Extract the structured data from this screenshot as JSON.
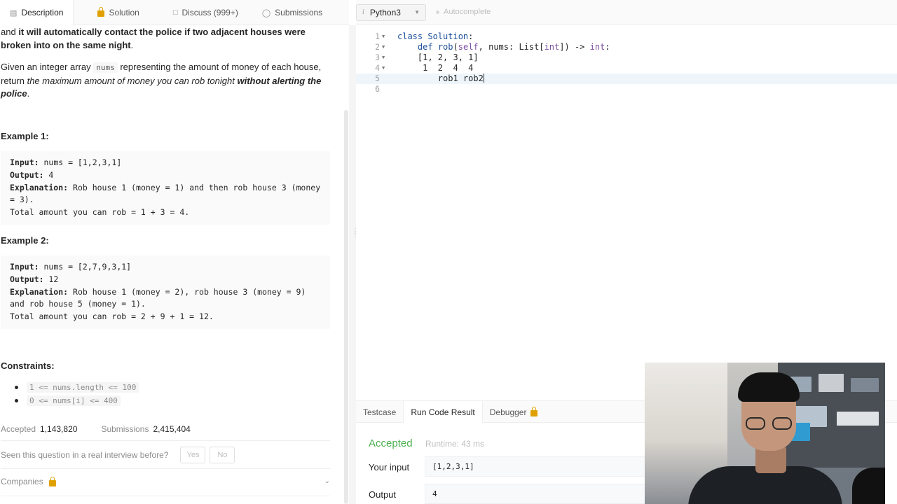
{
  "top_tabs": [
    {
      "label": "Description",
      "icon": "document-icon",
      "active": true
    },
    {
      "label": "Solution",
      "icon": "lock-icon"
    },
    {
      "label": "Discuss (999+)",
      "icon": "chat-icon"
    },
    {
      "label": "Submissions",
      "icon": "clock-icon"
    }
  ],
  "editor_toolbar": {
    "language": "Python3",
    "language_info_icon": "i",
    "autocomplete": "Autocomplete"
  },
  "description": {
    "intro_plain": "and ",
    "intro_bold": "it will automatically contact the police if two adjacent houses were broken into on the same night",
    "intro_end": ".",
    "task_a": "Given an integer array ",
    "task_code": "nums",
    "task_b": " representing the amount of money of each house, return ",
    "task_italic": "the maximum amount of money you can rob tonight",
    "task_space": " ",
    "task_bold_italic": "without alerting the police",
    "task_end": ".",
    "example1_title": "Example 1:",
    "example1": {
      "input_label": "Input:",
      "input": " nums = [1,2,3,1]",
      "output_label": "Output:",
      "output": " 4",
      "expl_label": "Explanation:",
      "expl_1": " Rob house 1 (money = 1) and then rob house 3 (money",
      "expl_2": "= 3).",
      "expl_3": "Total amount you can rob = 1 + 3 = 4."
    },
    "example2_title": "Example 2:",
    "example2": {
      "input_label": "Input:",
      "input": " nums = [2,7,9,3,1]",
      "output_label": "Output:",
      "output": " 12",
      "expl_label": "Explanation:",
      "expl_1": " Rob house 1 (money = 2), rob house 3 (money = 9)",
      "expl_2": "and rob house 5 (money = 1).",
      "expl_3": "Total amount you can rob = 2 + 9 + 1 = 12."
    },
    "constraints_title": "Constraints:",
    "constraints": [
      "1 <= nums.length <= 100",
      "0 <= nums[i] <= 400"
    ],
    "accepted_label": "Accepted",
    "accepted_value": "1,143,820",
    "submissions_label": "Submissions",
    "submissions_value": "2,415,404",
    "interview_question": "Seen this question in a real interview before?",
    "yes": "Yes",
    "no": "No",
    "companies": "Companies"
  },
  "code": {
    "line_numbers": [
      "1",
      "2",
      "3",
      "4",
      "5",
      "6"
    ],
    "line1": {
      "kw": "class",
      "name": "Solution",
      "rest": ":"
    },
    "line2": {
      "indent": "    ",
      "kw": "def",
      "fn": "rob",
      "p1": "(",
      "self": "self",
      "p2": ", nums: List[",
      "ty1": "int",
      "p3": "]) -> ",
      "ty2": "int",
      "p4": ":"
    },
    "line3": "    [1, 2, 3, 1]",
    "line4": "     1  2  4  4",
    "line5": "        rob1 rob2",
    "line6": ""
  },
  "console": {
    "tabs": [
      "Testcase",
      "Run Code Result",
      "Debugger"
    ],
    "status": "Accepted",
    "runtime": "Runtime: 43 ms",
    "input_label": "Your input",
    "input_value": "[1,2,3,1]",
    "output_label": "Output",
    "output_value": "4"
  },
  "colors": {
    "accepted_green": "#4caf50",
    "keyword_blue": "#1b4f9c",
    "lock_gold": "#e0a100"
  }
}
